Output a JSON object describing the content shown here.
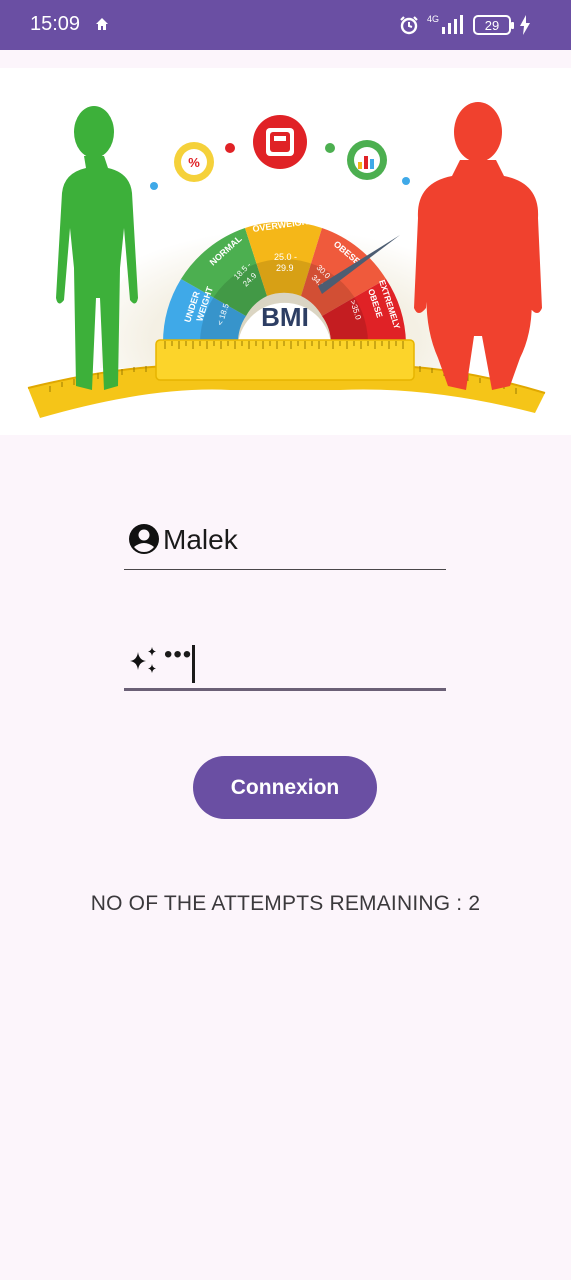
{
  "status_bar": {
    "time": "15:09",
    "network": "4G",
    "battery_level": "29",
    "icons": [
      "home-icon",
      "alarm-icon",
      "signal-icon",
      "battery-icon",
      "charging-icon"
    ]
  },
  "banner": {
    "center_label": "BMI",
    "categories": [
      {
        "name": "UNDER WEIGHT",
        "range": "< 18.5",
        "color": "#3fa9e8"
      },
      {
        "name": "NORMAL",
        "range": "18.5 - 24.9",
        "color": "#4caf50"
      },
      {
        "name": "OVERWEIGHT",
        "range": "25.0 - 29.9",
        "color": "#f5b718"
      },
      {
        "name": "OBESE",
        "range": "30.0 - 34.9",
        "color": "#ef5a3c"
      },
      {
        "name": "EXTREMELY OBESE",
        "range": ">35.0",
        "color": "#e02226"
      }
    ]
  },
  "login": {
    "username_value": "Malek",
    "password_mask": "•••",
    "submit_label": "Connexion",
    "attempts_text": "NO OF THE ATTEMPTS REMAINING : 2"
  },
  "colors": {
    "accent": "#6a4fa3",
    "background": "#fcf5fb"
  }
}
